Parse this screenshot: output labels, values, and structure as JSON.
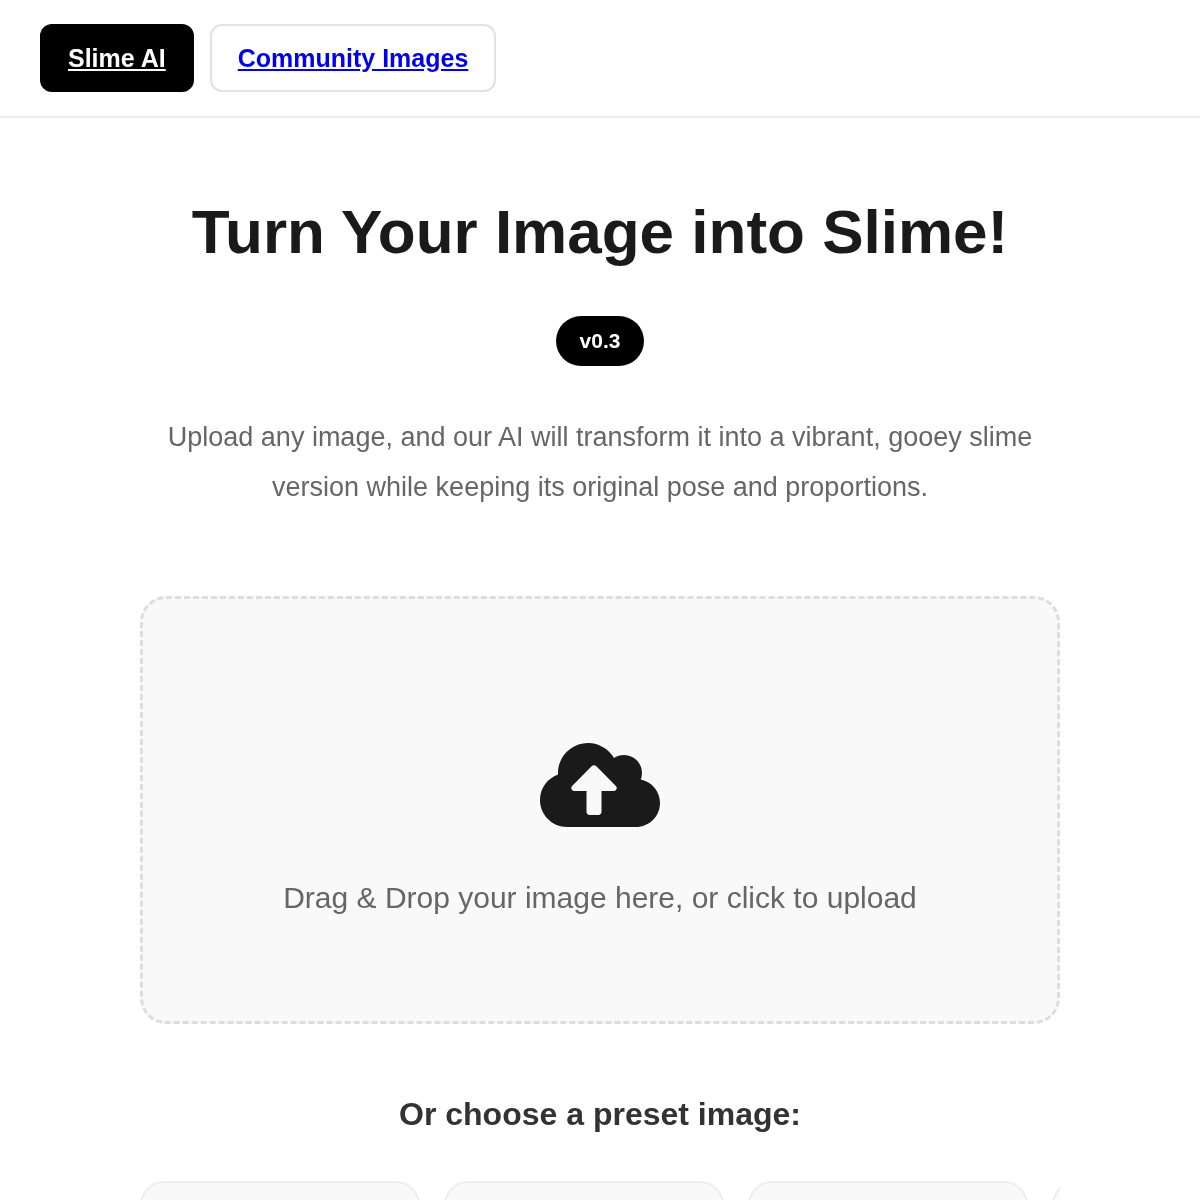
{
  "nav": [
    {
      "label": "Slime AI",
      "selected": true
    },
    {
      "label": "Community Images",
      "selected": false
    }
  ],
  "title": "Turn Your Image into Slime!",
  "version_badge": "v0.3",
  "description": "Upload any image, and our AI will transform it into a vibrant, gooey slime version while keeping its original pose and proportions.",
  "upload": {
    "prompt": "Drag & Drop your image here, or click to upload"
  },
  "presets": {
    "heading": "Or choose a preset image:",
    "items": [
      {
        "kind": "card"
      },
      {
        "kind": "card"
      },
      {
        "kind": "card"
      },
      {
        "kind": "card"
      }
    ]
  }
}
